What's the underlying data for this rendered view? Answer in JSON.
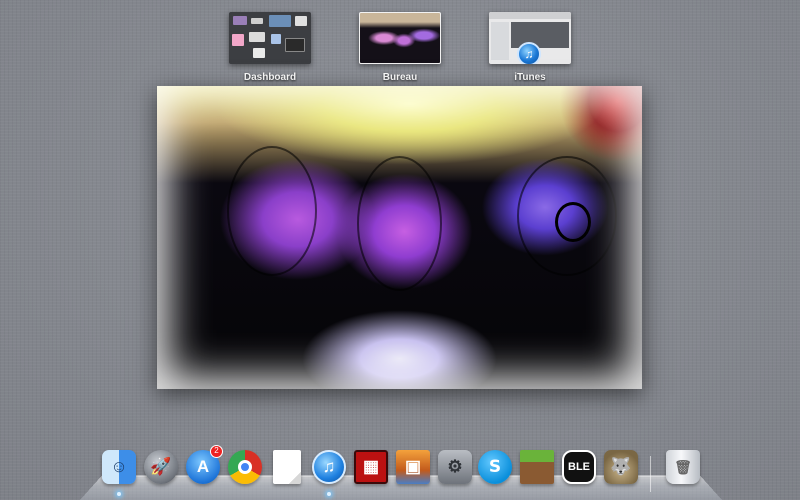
{
  "spaces": [
    {
      "label": "Dashboard"
    },
    {
      "label": "Bureau"
    },
    {
      "label": "iTunes"
    }
  ],
  "window": {
    "content": "photo"
  },
  "dock": {
    "items": [
      {
        "name": "Finder",
        "icon": "finder-icon",
        "running": true
      },
      {
        "name": "Launchpad",
        "icon": "rocket-icon",
        "running": false
      },
      {
        "name": "App Store",
        "icon": "app-store-icon",
        "running": false,
        "badge": "2"
      },
      {
        "name": "Google Chrome",
        "icon": "chrome-icon",
        "running": false
      },
      {
        "name": "Document",
        "icon": "document-icon",
        "running": false
      },
      {
        "name": "iTunes",
        "icon": "itunes-icon",
        "running": true
      },
      {
        "name": "Photo Booth",
        "icon": "photo-booth-icon",
        "running": false
      },
      {
        "name": "iPhoto",
        "icon": "iphoto-icon",
        "running": false
      },
      {
        "name": "System Preferences",
        "icon": "system-preferences-icon",
        "running": false
      },
      {
        "name": "Skype",
        "icon": "skype-icon",
        "running": false
      },
      {
        "name": "Minecraft",
        "icon": "minecraft-icon",
        "running": false
      },
      {
        "name": "BLE",
        "icon": "ble-icon",
        "running": false,
        "text": "BLE"
      },
      {
        "name": "GIMP",
        "icon": "gimp-icon",
        "running": false
      },
      {
        "name": "Trash",
        "icon": "trash-icon",
        "running": false
      }
    ]
  }
}
